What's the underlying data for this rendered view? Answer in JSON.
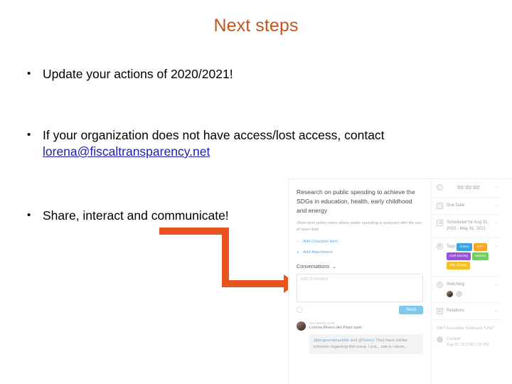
{
  "slide": {
    "title": "Next steps",
    "title_color": "#C5551A",
    "accent_color": "#E8541E",
    "bullets": [
      {
        "marker": "•",
        "text": "Update your actions of 2020/2021!"
      },
      {
        "marker": "•",
        "text": "If your organization does not have access/lost access, contact "
      },
      {
        "marker": "•",
        "text": "Share, interact and communicate!"
      }
    ],
    "email_link": "lorena@fiscaltransparency.net",
    "email_link_color": "#1F1FA8",
    "arrow": {
      "name": "elbow-arrow",
      "color": "#E8541E"
    }
  },
  "embedded": {
    "task": {
      "title": "Research on public spending to achieve the SDGs in education, health, early childhood and energy",
      "description": "Short-term policy notes where public spending is analyzed with the use of open data",
      "add_checklist_label": "Add Checklist Item",
      "add_checklist_icon": "−",
      "add_attachment_label": "Add Attachment",
      "add_attachment_icon": "+",
      "conversations_label": "Conversations",
      "conversations_chevron": "⌄",
      "comment_placeholder": "Add Comment",
      "send_label": "Send",
      "comment": {
        "time": "AN HOUR AGO",
        "author": "Lorena Rivero del Paso said",
        "body_mention_1": "@jorgeumanaubille",
        "body_middle": " and ",
        "body_mention_2": "@Sunny",
        "body_text": " They have similar interests regarding this issue. I put... see in conve..."
      }
    },
    "sidebar": {
      "timer_value": "00:00:00",
      "timer_icon": "▷",
      "due_date_label": "Due Date",
      "due_date_icon": "▢",
      "scheduled_label": "Scheduled for Aug 31, 2020 - May 31, 2021",
      "scheduled_icon": "⇉",
      "tags_label": "Tags",
      "tags_icon": "⚙",
      "tags": [
        {
          "label": "Action",
          "color": "#3FA0E0"
        },
        {
          "label": "GIFT",
          "color": "#F5A623"
        },
        {
          "label": "Civil Society",
          "color": "#9B51E0"
        },
        {
          "label": "Mexico",
          "color": "#6FCF5C"
        },
        {
          "label": "Use of data",
          "color": "#F2C029"
        }
      ],
      "watching_label": "Watching",
      "watching_icon": "◎",
      "relations_label": "Relations",
      "relations_icon": "⊞",
      "board_name": "GIFT Executive Testboard \"USE\"",
      "created_label": "Created",
      "created_value": "Aug 31, 20 2:00 7:16 PM",
      "created_icon": "⚙",
      "chevron": "⌄"
    }
  }
}
